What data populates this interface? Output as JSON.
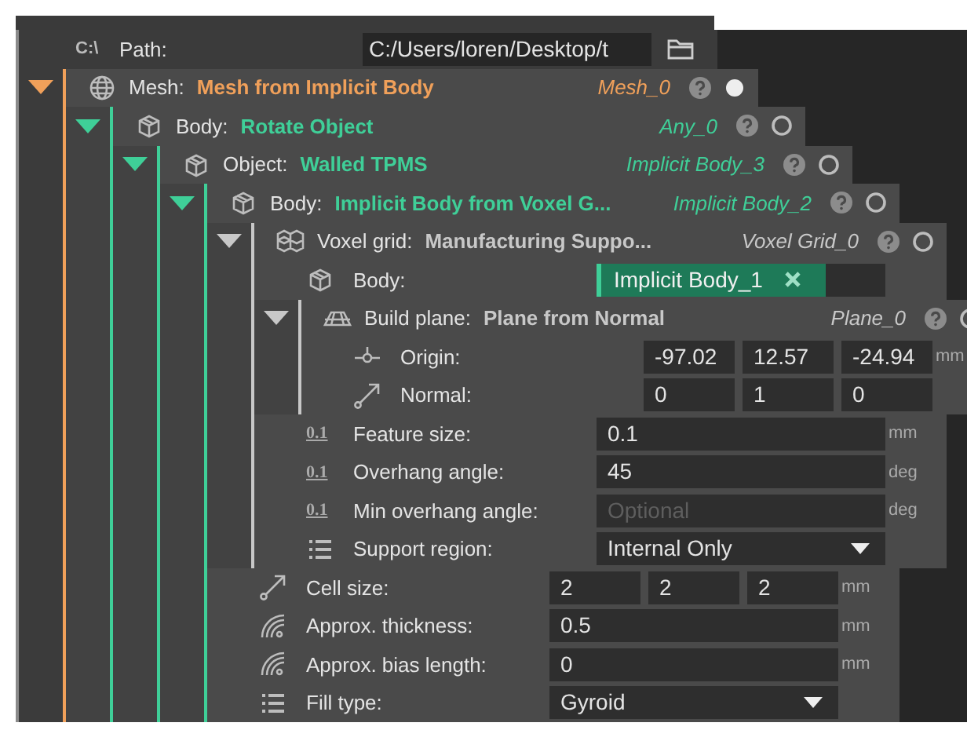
{
  "path": {
    "badge": "C:\\",
    "label": "Path:",
    "value": "C:/Users/loren/Desktop/t"
  },
  "tree": {
    "kind": "mesh",
    "label": "Mesh:",
    "value": "Mesh from Implicit Body",
    "ref": "Mesh_0",
    "color": "#f0a05a",
    "expanded": true,
    "active": true,
    "items": [
      {
        "kind": "body",
        "label": "Body:",
        "value": "Rotate Object",
        "ref": "Any_0",
        "color": "#3fcf98",
        "expanded": true,
        "active": false,
        "items": [
          {
            "kind": "body",
            "label": "Object:",
            "value": "Walled TPMS",
            "ref": "Implicit Body_3",
            "color": "#3fcf98",
            "expanded": true,
            "active": false,
            "items": [
              {
                "kind": "body",
                "label": "Body:",
                "value": "Implicit Body from Voxel G...",
                "ref": "Implicit Body_2",
                "color": "#3fcf98",
                "expanded": true,
                "active": false,
                "items": [
                  {
                    "kind": "voxel_grid",
                    "label": "Voxel grid:",
                    "value": "Manufacturing Suppo...",
                    "ref": "Voxel Grid_0",
                    "color": "#c8c8c8",
                    "expanded": true,
                    "active": false,
                    "items": [
                      {
                        "kind": "reference",
                        "label": "Body:",
                        "value": "Implicit Body_1"
                      },
                      {
                        "kind": "plane",
                        "label": "Build plane:",
                        "value": "Plane from Normal",
                        "ref": "Plane_0",
                        "color": "#c8c8c8",
                        "expanded": true,
                        "active": false,
                        "items": [
                          {
                            "kind": "point",
                            "label": "Origin:",
                            "values": [
                              "-97.02",
                              "12.57",
                              "-24.94"
                            ],
                            "unit": "mm"
                          },
                          {
                            "kind": "direction",
                            "label": "Normal:",
                            "values": [
                              "0",
                              "1",
                              "0"
                            ]
                          }
                        ]
                      },
                      {
                        "kind": "scalar",
                        "badge": "0.1",
                        "label": "Feature size:",
                        "value": "0.1",
                        "unit": "mm"
                      },
                      {
                        "kind": "scalar",
                        "badge": "0.1",
                        "label": "Overhang angle:",
                        "value": "45",
                        "unit": "deg"
                      },
                      {
                        "kind": "scalar",
                        "badge": "0.1",
                        "label": "Min overhang angle:",
                        "placeholder": "Optional",
                        "unit": "deg"
                      },
                      {
                        "kind": "choice",
                        "label": "Support region:",
                        "value": "Internal Only"
                      }
                    ]
                  },
                  {
                    "kind": "direction",
                    "label": "Cell size:",
                    "values": [
                      "2",
                      "2",
                      "2"
                    ],
                    "unit": "mm"
                  },
                  {
                    "kind": "thickness",
                    "label": "Approx. thickness:",
                    "value": "0.5",
                    "unit": "mm"
                  },
                  {
                    "kind": "thickness",
                    "label": "Approx. bias length:",
                    "value": "0",
                    "unit": "mm"
                  },
                  {
                    "kind": "choice",
                    "label": "Fill type:",
                    "value": "Gyroid"
                  }
                ]
              }
            ]
          }
        ]
      }
    ]
  }
}
